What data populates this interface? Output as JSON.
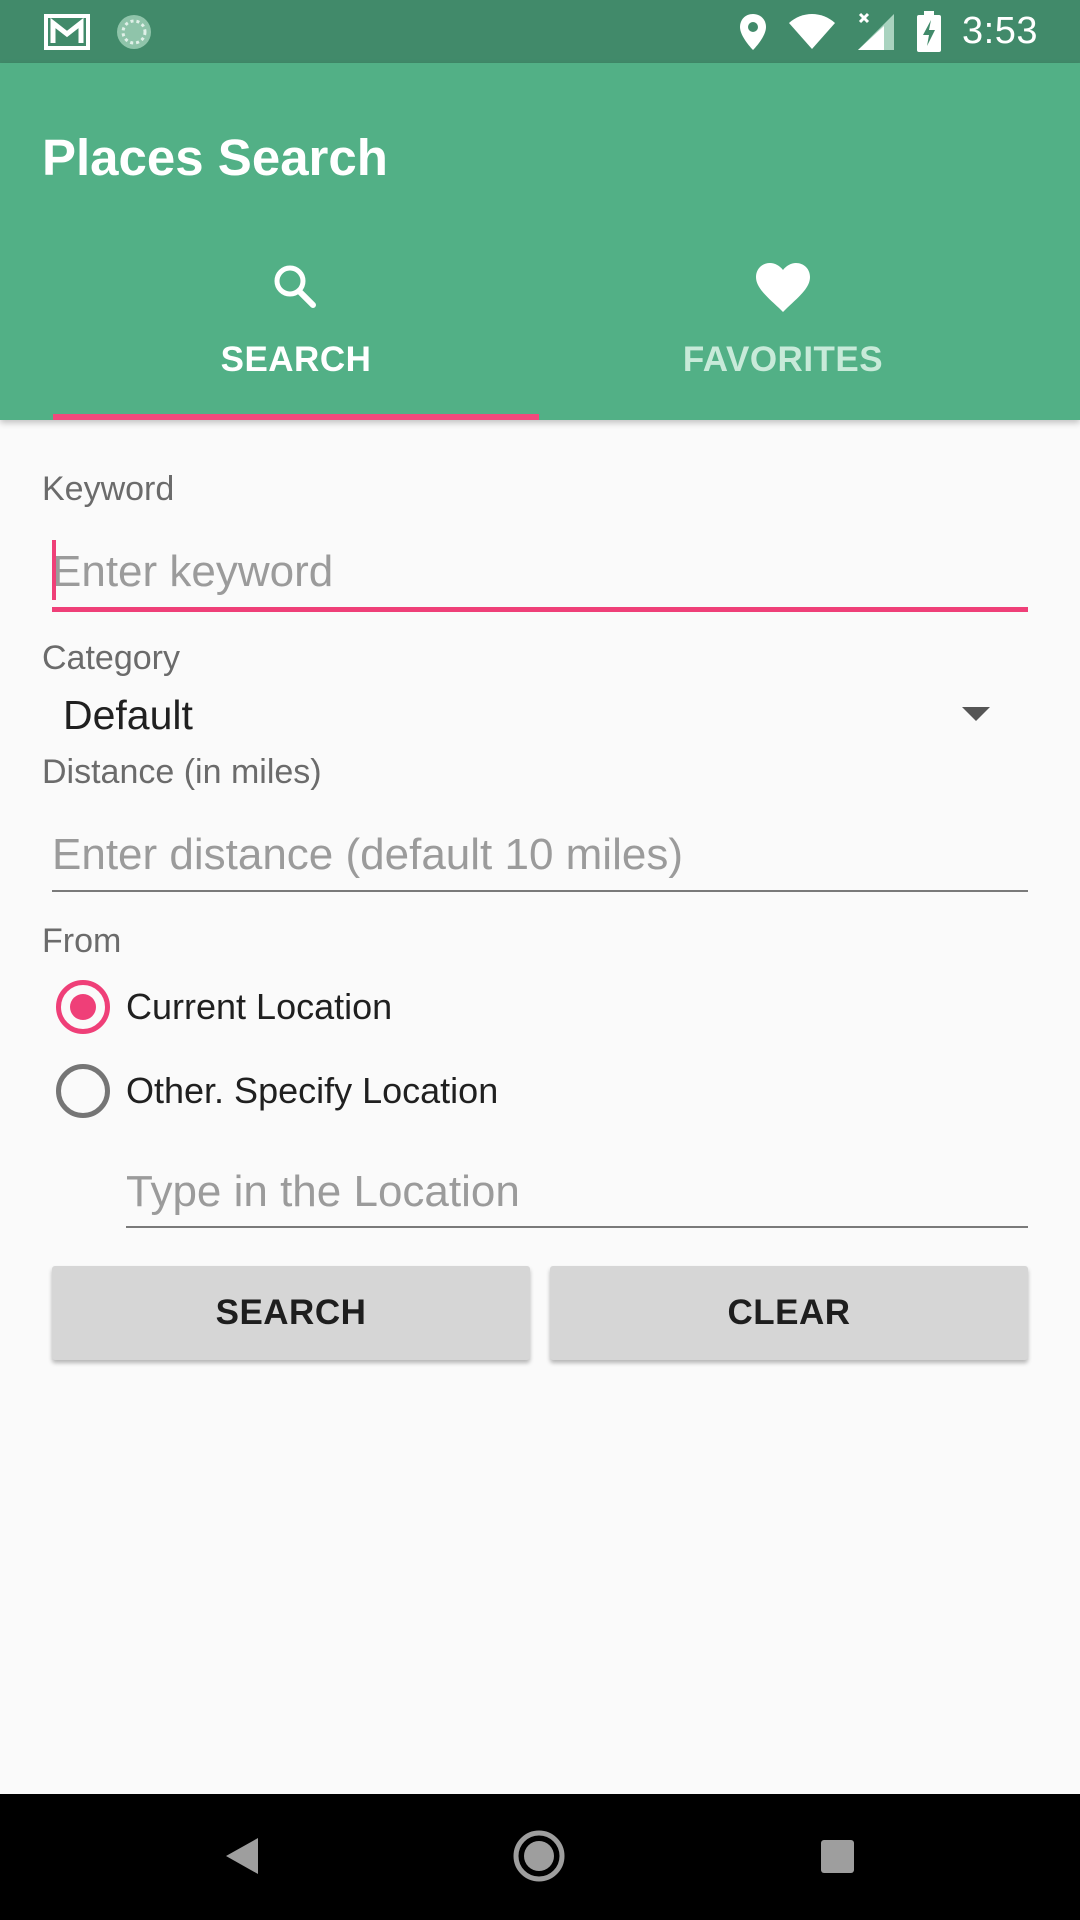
{
  "status_bar": {
    "time": "3:53",
    "icons_left": [
      "gmail-icon",
      "sync-icon"
    ],
    "icons_right": [
      "location-icon",
      "wifi-icon",
      "signal-icon",
      "battery-charging-icon"
    ]
  },
  "app_bar": {
    "title": "Places Search",
    "tabs": [
      {
        "label": "SEARCH",
        "icon": "search-icon",
        "selected": true
      },
      {
        "label": "FAVORITES",
        "icon": "heart-icon",
        "selected": false
      }
    ]
  },
  "form": {
    "keyword": {
      "label": "Keyword",
      "placeholder": "Enter keyword",
      "value": ""
    },
    "category": {
      "label": "Category",
      "selected": "Default"
    },
    "distance": {
      "label": "Distance (in miles)",
      "placeholder": "Enter distance (default 10 miles)",
      "value": ""
    },
    "from": {
      "label": "From",
      "options": [
        {
          "label": "Current Location",
          "checked": true
        },
        {
          "label": "Other. Specify Location",
          "checked": false
        }
      ],
      "location_placeholder": "Type in the Location"
    },
    "buttons": {
      "search": "SEARCH",
      "clear": "CLEAR"
    }
  },
  "colors": {
    "status_bar": "#418a6a",
    "app_bar": "#52b086",
    "accent": "#ef3f78",
    "background": "#fafafa",
    "button": "#d6d6d6"
  },
  "nav_bar": {
    "buttons": [
      "back-icon",
      "home-icon",
      "recents-icon"
    ]
  }
}
